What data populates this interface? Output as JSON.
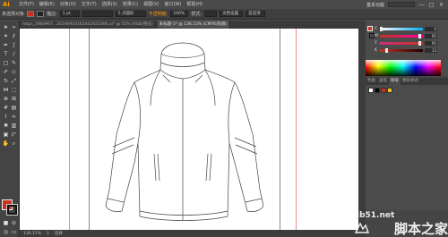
{
  "app": {
    "logo": "Ai",
    "menus": [
      "文件(F)",
      "编辑(E)",
      "对象(O)",
      "文字(T)",
      "选择(S)",
      "效果(C)",
      "视图(V)",
      "窗口(W)",
      "帮助(H)"
    ],
    "workspace": "基本功能",
    "window_controls": [
      "—",
      "□",
      "✕"
    ]
  },
  "controlbar": {
    "selection_label": "未选择对象",
    "stroke_label": "描边:",
    "stroke_weight": "1 pt",
    "brush_preset": "5 点圆形",
    "opacity_label": "不透明度:",
    "opacity_value": "100%",
    "style_label": "样式:",
    "doc_setup": "文档设置",
    "preferences": "首选项"
  },
  "tabs": [
    {
      "label": "https_2984967...20190910162432421000.ai* @ 55% (RGB/预览)",
      "active": false
    },
    {
      "label": "未标题-1* @ 136.15% (CMYK/轮廓)",
      "active": true
    }
  ],
  "statusbar": {
    "zoom": "136.15%",
    "artboard": "1",
    "tool": "选择"
  },
  "color_panel": {
    "fill_color": "#c8321e",
    "sliders": [
      {
        "label": "C",
        "value": "0",
        "fraction": 0.0
      },
      {
        "label": "M",
        "value": "95",
        "fraction": 0.95
      },
      {
        "label": "Y",
        "value": "95",
        "fraction": 0.95
      },
      {
        "label": "K",
        "value": "13",
        "fraction": 0.13
      }
    ]
  },
  "panel_tabs": [
    "色板",
    "画笔",
    "符号",
    "图形样式"
  ],
  "watermark": {
    "url": "jb51.net",
    "brand": "脚本之家"
  },
  "colors": {
    "accent": "#ff9a00",
    "fill": "#c8321e"
  }
}
